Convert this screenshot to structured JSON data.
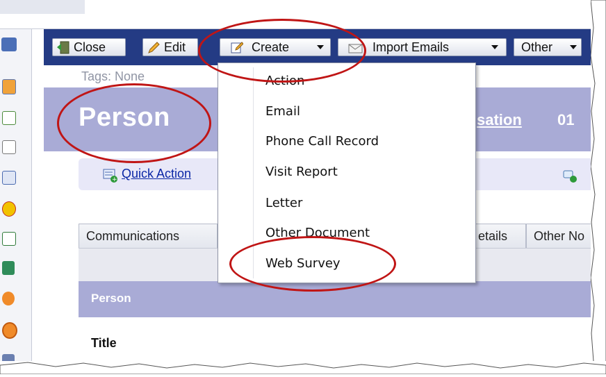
{
  "toolbar": {
    "close_label": "Close",
    "edit_label": "Edit",
    "create_label": "Create",
    "import_emails_label": "Import Emails",
    "other_label": "Other"
  },
  "header": {
    "tags": "Tags: None",
    "title": "Person",
    "conversation_link": "sation",
    "conversation_number": "01"
  },
  "quick_action": {
    "label": "Quick Action"
  },
  "tabs": [
    {
      "label": "Communications"
    },
    {
      "label": "etails"
    },
    {
      "label": "Other No"
    }
  ],
  "section": {
    "title": "Person",
    "field_label": "Title"
  },
  "create_menu": {
    "items": [
      {
        "label": "Action"
      },
      {
        "label": "Email"
      },
      {
        "label": "Phone Call Record"
      },
      {
        "label": "Visit Report"
      },
      {
        "label": "Letter"
      },
      {
        "label": "Other Document"
      },
      {
        "label": "Web Survey"
      }
    ]
  },
  "colors": {
    "toolbar": "#243b84",
    "title_band": "#a9abd6",
    "annotation": "#c01515",
    "link": "#0b27a6"
  },
  "icons": {
    "rail": [
      "binoculars-icon",
      "contact-icon",
      "calendar-icon",
      "notes-icon",
      "grid-calendar-icon",
      "award-icon",
      "checklist-icon",
      "sync-icon",
      "person-icon",
      "target-icon"
    ],
    "toolbar": [
      "close-door-icon",
      "pencil-icon",
      "edit-doc-icon",
      "envelope-import-icon"
    ]
  }
}
